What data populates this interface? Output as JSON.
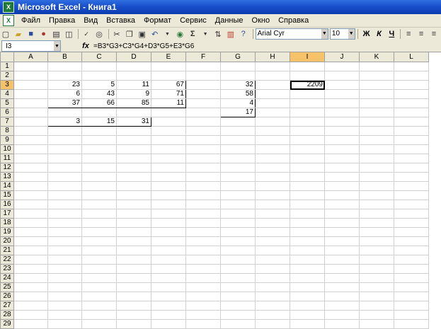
{
  "window": {
    "title": "Microsoft Excel - Книга1"
  },
  "menu": [
    "Файл",
    "Правка",
    "Вид",
    "Вставка",
    "Формат",
    "Сервис",
    "Данные",
    "Окно",
    "Справка"
  ],
  "toolbar": {
    "font_name": "Arial Cyr",
    "font_size": "10",
    "bold": "Ж",
    "italic": "К",
    "underline": "Ч",
    "sum": "Σ"
  },
  "formula_bar": {
    "name_box": "I3",
    "fx": "fx",
    "formula": "=B3*G3+C3*G4+D3*G5+E3*G6"
  },
  "columns": [
    "A",
    "B",
    "C",
    "D",
    "E",
    "F",
    "G",
    "H",
    "I",
    "J",
    "K",
    "L"
  ],
  "rows": [
    "1",
    "2",
    "3",
    "4",
    "5",
    "6",
    "7",
    "8",
    "9",
    "10",
    "11",
    "12",
    "13",
    "14",
    "15",
    "16",
    "17",
    "18",
    "19",
    "20",
    "21",
    "22",
    "23",
    "24",
    "25",
    "26",
    "27",
    "28",
    "29"
  ],
  "cells": {
    "B3": "23",
    "C3": "5",
    "D3": "11",
    "E3": "67",
    "B4": "6",
    "C4": "43",
    "D4": "9",
    "E4": "71",
    "B5": "37",
    "C5": "66",
    "D5": "85",
    "E5": "11",
    "B7": "3",
    "C7": "15",
    "D7": "31",
    "G3": "32",
    "G4": "58",
    "G5": "4",
    "G6": "17",
    "I3": "2209"
  }
}
